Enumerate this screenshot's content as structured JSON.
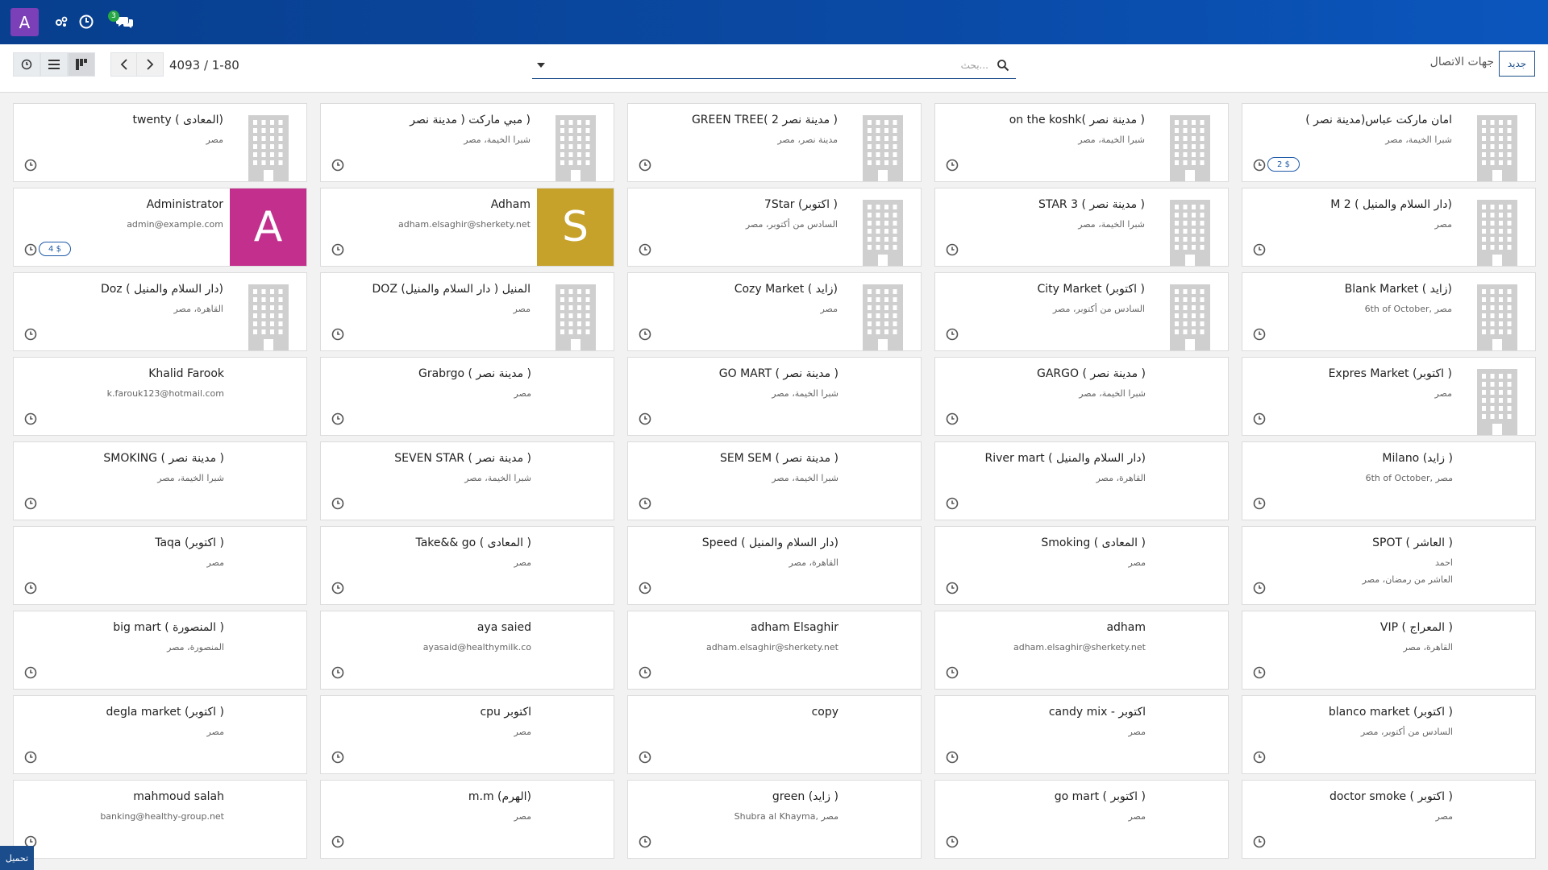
{
  "header": {
    "avatar_letter": "A",
    "avatar_color": "#7b3fb8",
    "messages_badge": "3",
    "icons": [
      "apps-icon",
      "clock-icon",
      "chat-icon"
    ]
  },
  "control": {
    "pager": "4093 / 1-80",
    "search_placeholder": "بحث...",
    "new_button": "جديد",
    "title": "جهات الاتصال"
  },
  "colors": {
    "topbar": "#0a4aa6",
    "accent": "#1f4f8b",
    "avatar_magenta": "#c22f8d",
    "avatar_gold": "#c6a22b"
  },
  "cards": [
    {
      "title": "twenty ( المعادى)",
      "l1": "مصر",
      "l2": "",
      "image": "building",
      "badge": ""
    },
    {
      "title": "( مبي ماركت ( مدينة نصر",
      "l1": "شبرا الخيمة، مصر",
      "l2": "",
      "image": "building",
      "badge": ""
    },
    {
      "title": "GREEN TREE( 2 مدينة نصر )",
      "l1": "مدينة نصر، مصر",
      "l2": "",
      "image": "building",
      "badge": ""
    },
    {
      "title": "on the koshk( مدينة نصر )",
      "l1": "شبرا الخيمة، مصر",
      "l2": "",
      "image": "building",
      "badge": ""
    },
    {
      "title": "امان ماركت عباس(مدينة نصر )",
      "l1": "شبرا الخيمة، مصر",
      "l2": "",
      "image": "building",
      "badge": "2 $"
    },
    {
      "title": "Administrator",
      "l1": "admin@example.com",
      "l2": "",
      "image": "letter",
      "letter": "A",
      "badge": "4 $"
    },
    {
      "title": "Adham",
      "l1": "adham.elsaghir@sherkety.net",
      "l2": "",
      "image": "letter",
      "letter": "S",
      "badge": ""
    },
    {
      "title": "7Star (اكتوبر )",
      "l1": "السادس من أكتوبر، مصر",
      "l2": "",
      "image": "building",
      "badge": ""
    },
    {
      "title": "STAR 3 ( مدينة نصر )",
      "l1": "شبرا الخيمة، مصر",
      "l2": "",
      "image": "building",
      "badge": ""
    },
    {
      "title": "M 2 ( دار السلام والمنيل)",
      "l1": "مصر",
      "l2": "",
      "image": "building",
      "badge": ""
    },
    {
      "title": "Doz ( دار السلام والمنيل)",
      "l1": "القاهرة، مصر",
      "l2": "",
      "image": "building",
      "badge": ""
    },
    {
      "title": "DOZ المنيل ( دار السلام والمنيل)",
      "l1": "مصر",
      "l2": "",
      "image": "building",
      "badge": ""
    },
    {
      "title": "Cozy Market ( زايد)",
      "l1": "مصر",
      "l2": "",
      "image": "building",
      "badge": ""
    },
    {
      "title": "City Market (اكتوبر )",
      "l1": "السادس من أكتوبر، مصر",
      "l2": "",
      "image": "building",
      "badge": ""
    },
    {
      "title": "Blank Market ( زايد)",
      "l1": "6th of October, مصر",
      "l2": "",
      "image": "building",
      "badge": ""
    },
    {
      "title": "Khalid Farook",
      "l1": "k.farouk123@hotmail.com",
      "l2": "",
      "image": "none",
      "badge": ""
    },
    {
      "title": "Grabrgo ( مدينة نصر )",
      "l1": "مصر",
      "l2": "",
      "image": "none",
      "badge": ""
    },
    {
      "title": "GO MART ( مدينة نصر )",
      "l1": "شبرا الخيمة، مصر",
      "l2": "",
      "image": "none",
      "badge": ""
    },
    {
      "title": "GARGO ( مدينة نصر )",
      "l1": "شبرا الخيمة، مصر",
      "l2": "",
      "image": "none",
      "badge": ""
    },
    {
      "title": "Expres Market (اكتوبر )",
      "l1": "مصر",
      "l2": "",
      "image": "building",
      "badge": ""
    },
    {
      "title": "SMOKING ( مدينة نصر )",
      "l1": "شبرا الخيمة، مصر",
      "l2": "",
      "image": "none",
      "badge": ""
    },
    {
      "title": "SEVEN STAR ( مدينة نصر )",
      "l1": "شبرا الخيمة، مصر",
      "l2": "",
      "image": "none",
      "badge": ""
    },
    {
      "title": "SEM SEM ( مدينة نصر )",
      "l1": "شبرا الخيمة، مصر",
      "l2": "",
      "image": "none",
      "badge": ""
    },
    {
      "title": "River mart ( دار السلام والمنيل)",
      "l1": "القاهرة، مصر",
      "l2": "",
      "image": "none",
      "badge": ""
    },
    {
      "title": "Milano (زايد )",
      "l1": "6th of October, مصر",
      "l2": "",
      "image": "none",
      "badge": ""
    },
    {
      "title": "Taqa (اكتوبر )",
      "l1": "مصر",
      "l2": "",
      "image": "none",
      "badge": ""
    },
    {
      "title": "Take&& go ( المعادى )",
      "l1": "مصر",
      "l2": "",
      "image": "none",
      "badge": ""
    },
    {
      "title": "Speed ( دار السلام والمنيل)",
      "l1": "القاهرة، مصر",
      "l2": "",
      "image": "none",
      "badge": ""
    },
    {
      "title": "Smoking ( المعادى )",
      "l1": "مصر",
      "l2": "",
      "image": "none",
      "badge": ""
    },
    {
      "title": "SPOT ( العاشر )",
      "l1": "احمد",
      "l2": "العاشر من رمضان، مصر",
      "image": "none",
      "badge": ""
    },
    {
      "title": "big mart ( المنصورة )",
      "l1": "المنصورة، مصر",
      "l2": "",
      "image": "none",
      "badge": ""
    },
    {
      "title": "aya saied",
      "l1": "ayasaid@healthymilk.co",
      "l2": "",
      "image": "none",
      "badge": ""
    },
    {
      "title": "adham Elsaghir",
      "l1": "adham.elsaghir@sherkety.net",
      "l2": "",
      "image": "none",
      "badge": ""
    },
    {
      "title": "adham",
      "l1": "adham.elsaghir@sherkety.net",
      "l2": "",
      "image": "none",
      "badge": ""
    },
    {
      "title": "VIP ( المعراج )",
      "l1": "القاهرة، مصر",
      "l2": "",
      "image": "none",
      "badge": ""
    },
    {
      "title": "degla market (اكتوبر )",
      "l1": "مصر",
      "l2": "",
      "image": "none",
      "badge": ""
    },
    {
      "title": "cpu اكتوبر",
      "l1": "مصر",
      "l2": "",
      "image": "none",
      "badge": ""
    },
    {
      "title": "copy",
      "l1": "",
      "l2": "",
      "image": "none",
      "badge": ""
    },
    {
      "title": "candy mix - اكتوبر",
      "l1": "مصر",
      "l2": "",
      "image": "none",
      "badge": ""
    },
    {
      "title": "blanco market (اكتوبر )",
      "l1": "السادس من أكتوبر، مصر",
      "l2": "",
      "image": "none",
      "badge": ""
    },
    {
      "title": "mahmoud salah",
      "l1": "banking@healthy-group.net",
      "l2": "",
      "image": "none",
      "badge": ""
    },
    {
      "title": "m.m (الهرم)",
      "l1": "مصر",
      "l2": "",
      "image": "none",
      "badge": ""
    },
    {
      "title": "green (زايد )",
      "l1": "Shubra al Khayma, مصر",
      "l2": "",
      "image": "none",
      "badge": ""
    },
    {
      "title": "go mart ( اكتوبر )",
      "l1": "مصر",
      "l2": "",
      "image": "none",
      "badge": ""
    },
    {
      "title": "doctor smoke ( اكتوبر )",
      "l1": "مصر",
      "l2": "",
      "image": "none",
      "badge": ""
    }
  ],
  "footer": {
    "download_label": "تحميل"
  }
}
